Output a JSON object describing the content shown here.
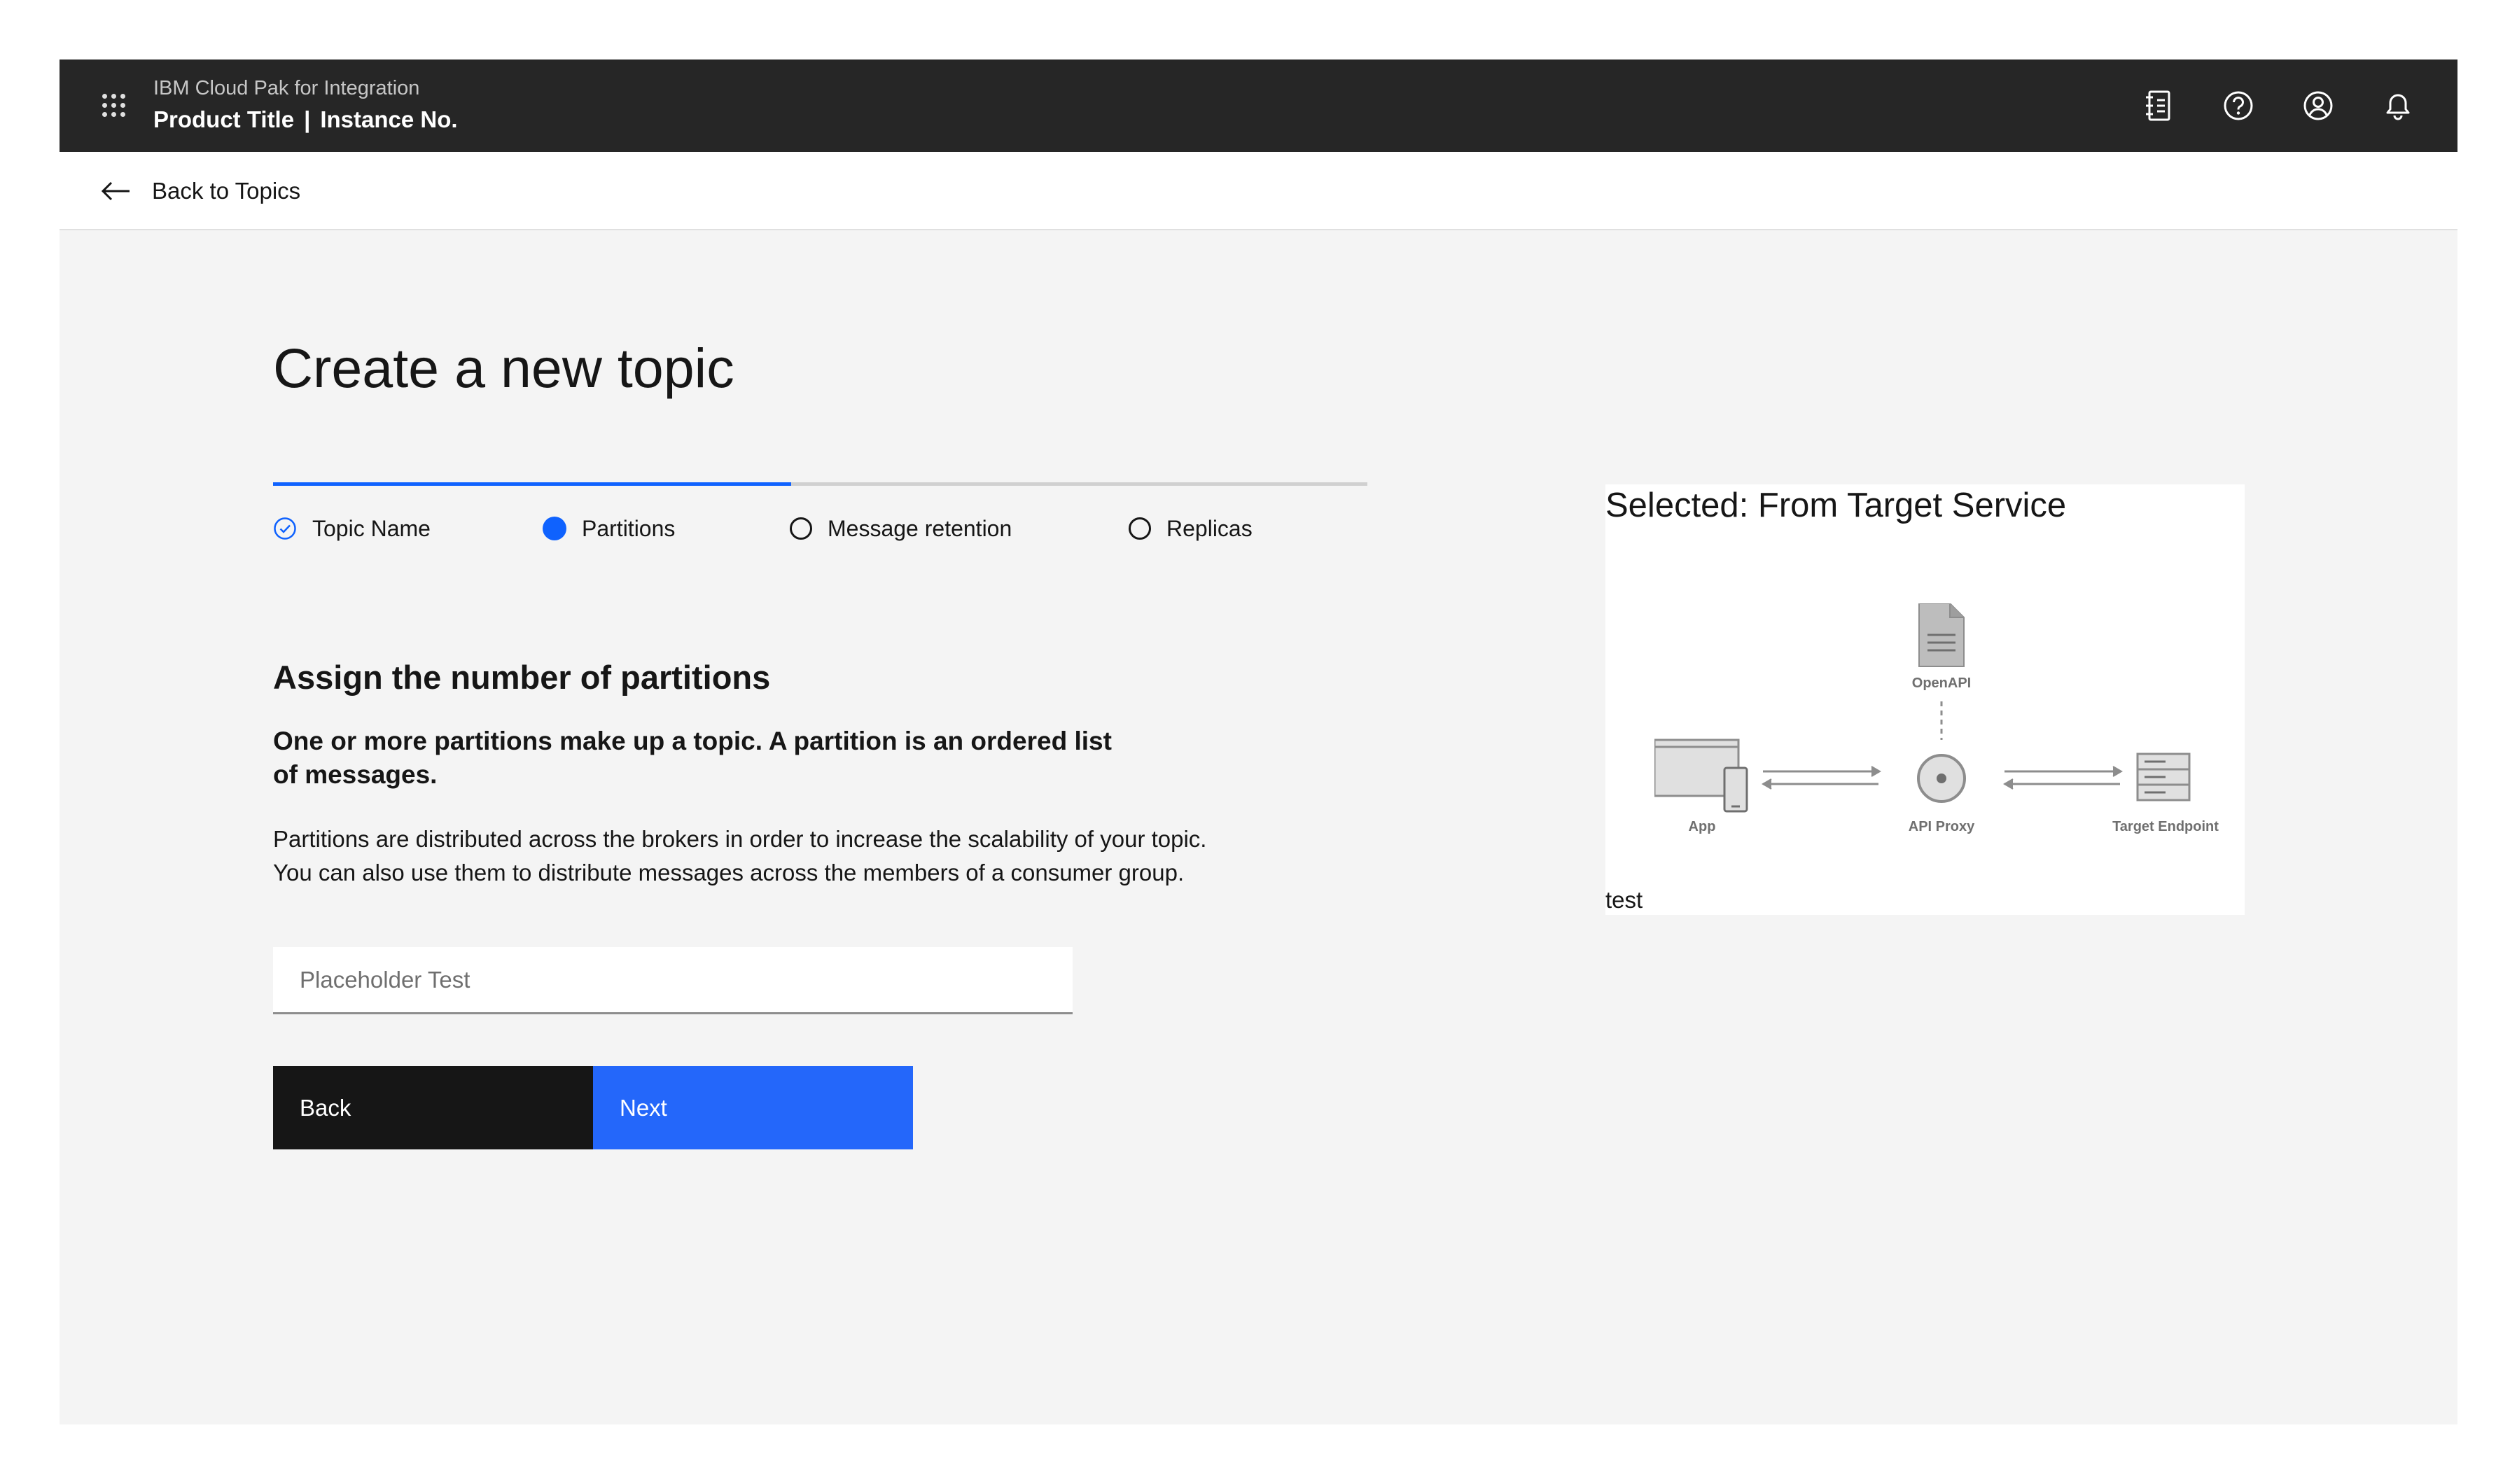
{
  "header": {
    "subtitle": "IBM Cloud Pak for Integration",
    "product_title": "Product Title",
    "separator": "|",
    "instance": "Instance No.",
    "icons": [
      "app-switcher-icon",
      "notebook-icon",
      "help-icon",
      "user-avatar-icon",
      "notification-icon"
    ]
  },
  "back": {
    "label": "Back to Topics"
  },
  "page": {
    "title": "Create a new topic",
    "steps": [
      {
        "label": "Topic Name",
        "state": "complete"
      },
      {
        "label": "Partitions",
        "state": "current"
      },
      {
        "label": "Message retention",
        "state": "incomplete"
      },
      {
        "label": "Replicas",
        "state": "incomplete"
      }
    ],
    "section_title": "Assign the number of partitions",
    "lead": "One or more partitions make up a topic. A partition is an ordered list of messages.",
    "body": "Partitions are distributed across the brokers in order to increase the scalability of your topic. You can also use them to distribute messages across the members of a consumer group.",
    "input": {
      "placeholder": "Placeholder Test",
      "value": ""
    },
    "buttons": {
      "back": "Back",
      "next": "Next"
    }
  },
  "tile": {
    "title": "Selected: From Target Service",
    "diagram": {
      "labels": {
        "openapi": "OpenAPI",
        "app": "App",
        "proxy": "API Proxy",
        "target": "Target Endpoint"
      }
    },
    "caption": "test"
  },
  "colors": {
    "header_bg": "#262626",
    "accent": "#0f62fe",
    "next_button": "#2467fa",
    "back_button": "#161616",
    "canvas": "#f4f4f4"
  }
}
